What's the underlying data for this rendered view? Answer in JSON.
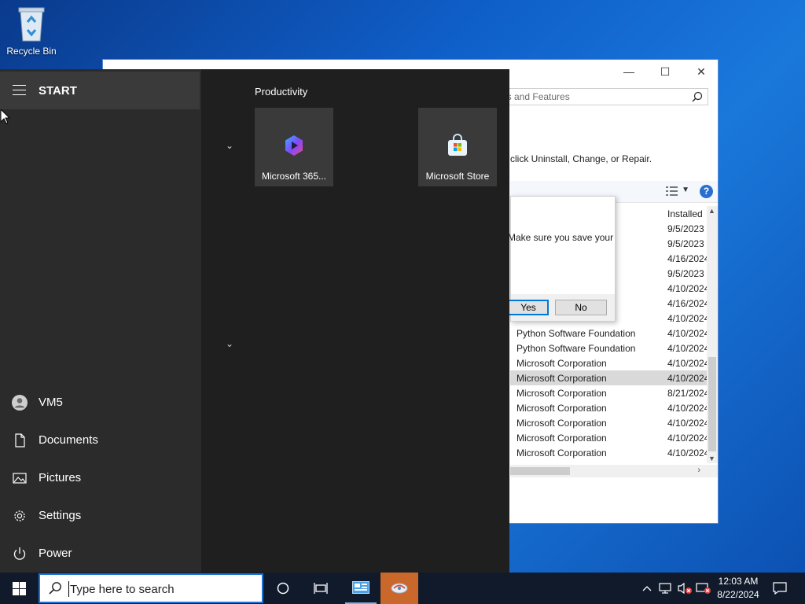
{
  "desktop": {
    "icons": [
      {
        "label": "Recycle Bin",
        "icon": "recycle-bin-icon"
      }
    ]
  },
  "control_panel": {
    "search_placeholder": "ns and Features",
    "description": "click Uninstall, Change, or Repair.",
    "column_installed": "Installed",
    "rows": [
      {
        "publisher": "",
        "date": "9/5/2023"
      },
      {
        "publisher": "",
        "date": "9/5/2023"
      },
      {
        "publisher": "",
        "date": "4/16/2024"
      },
      {
        "publisher": "",
        "date": "9/5/2023"
      },
      {
        "publisher": "",
        "date": "4/10/2024"
      },
      {
        "publisher": "",
        "date": "4/16/2024"
      },
      {
        "publisher": "",
        "date": "4/10/2024"
      },
      {
        "publisher": "Python Software Foundation",
        "date": "4/10/2024"
      },
      {
        "publisher": "Python Software Foundation",
        "date": "4/10/2024"
      },
      {
        "publisher": "Microsoft Corporation",
        "date": "4/10/2024"
      },
      {
        "publisher": "Microsoft Corporation",
        "date": "4/10/2024",
        "selected": true
      },
      {
        "publisher": "Microsoft Corporation",
        "date": "8/21/2024"
      },
      {
        "publisher": "Microsoft Corporation",
        "date": "4/10/2024"
      },
      {
        "publisher": "Microsoft Corporation",
        "date": "4/10/2024"
      },
      {
        "publisher": "Microsoft Corporation",
        "date": "4/10/2024"
      },
      {
        "publisher": "Microsoft Corporation",
        "date": "4/10/2024"
      }
    ],
    "dialog": {
      "message": "Make sure you save your",
      "yes_label": "Yes",
      "no_label": "No"
    }
  },
  "start_menu": {
    "title": "START",
    "left_items": [
      {
        "label": "VM5",
        "icon": "user-avatar-icon"
      },
      {
        "label": "Documents",
        "icon": "document-icon"
      },
      {
        "label": "Pictures",
        "icon": "pictures-icon"
      },
      {
        "label": "Settings",
        "icon": "gear-icon"
      },
      {
        "label": "Power",
        "icon": "power-icon"
      }
    ],
    "group_label": "Productivity",
    "tiles": [
      {
        "label": "Microsoft 365...",
        "icon": "microsoft-365-icon"
      },
      {
        "label": "Microsoft Store",
        "icon": "microsoft-store-icon"
      }
    ]
  },
  "taskbar": {
    "search_placeholder": "Type here to search",
    "time": "12:03 AM",
    "date": "8/22/2024"
  },
  "colors": {
    "taskbar_bg": "#101a2b",
    "start_bg": "#1f1f1f",
    "active_app": "#c9682a",
    "accent": "#0078d7"
  }
}
